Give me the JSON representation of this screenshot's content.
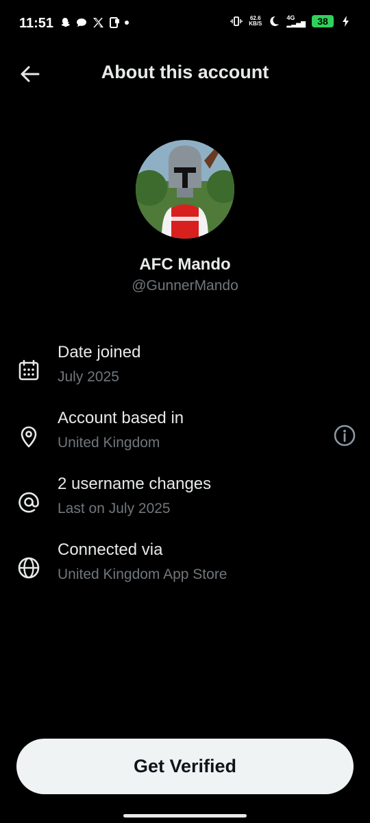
{
  "status_bar": {
    "time": "11:51",
    "net_speed_value": "62.6",
    "net_speed_unit": "KB/S",
    "network": "4G",
    "battery": "38",
    "battery_color": "#2fd15a"
  },
  "header": {
    "title": "About this account"
  },
  "profile": {
    "display_name": "AFC Mando",
    "handle": "@GunnerMando"
  },
  "details": [
    {
      "icon": "calendar-icon",
      "title": "Date joined",
      "subtitle": "July 2025"
    },
    {
      "icon": "location-pin-icon",
      "title": "Account based in",
      "subtitle": "United Kingdom"
    },
    {
      "icon": "at-sign-icon",
      "title": "2 username changes",
      "subtitle": "Last on July 2025"
    },
    {
      "icon": "globe-icon",
      "title": "Connected via",
      "subtitle": "United Kingdom App Store"
    }
  ],
  "cta": {
    "label": "Get Verified"
  },
  "colors": {
    "background": "#000000",
    "primary_text": "#e7e9ea",
    "secondary_text": "#71767b",
    "button_bg": "#eff3f4"
  }
}
